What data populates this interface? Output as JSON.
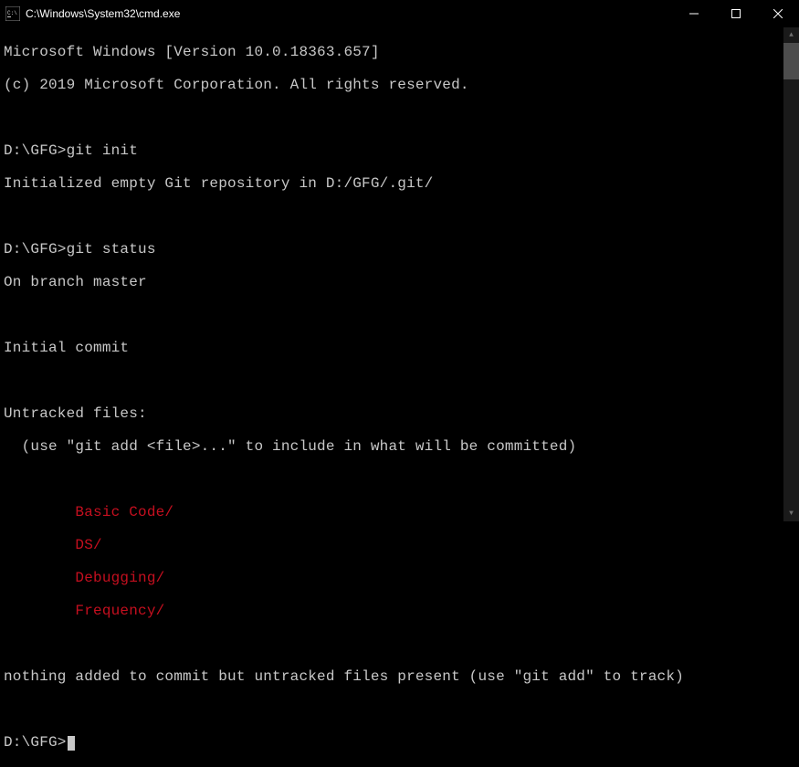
{
  "window": {
    "title": "C:\\Windows\\System32\\cmd.exe",
    "icon_name": "cmd-icon"
  },
  "terminal": {
    "header1": "Microsoft Windows [Version 10.0.18363.657]",
    "header2": "(c) 2019 Microsoft Corporation. All rights reserved.",
    "blank": "",
    "prompt1": "D:\\GFG>",
    "cmd1": "git init",
    "out1": "Initialized empty Git repository in D:/GFG/.git/",
    "prompt2": "D:\\GFG>",
    "cmd2": "git status",
    "status_branch": "On branch master",
    "status_initial": "Initial commit",
    "untracked_header": "Untracked files:",
    "untracked_hint": "  (use \"git add <file>...\" to include in what will be committed)",
    "untracked_indent": "        ",
    "untracked": [
      "Basic Code/",
      "DS/",
      "Debugging/",
      "Frequency/"
    ],
    "nothing_added": "nothing added to commit but untracked files present (use \"git add\" to track)",
    "prompt3": "D:\\GFG>"
  }
}
